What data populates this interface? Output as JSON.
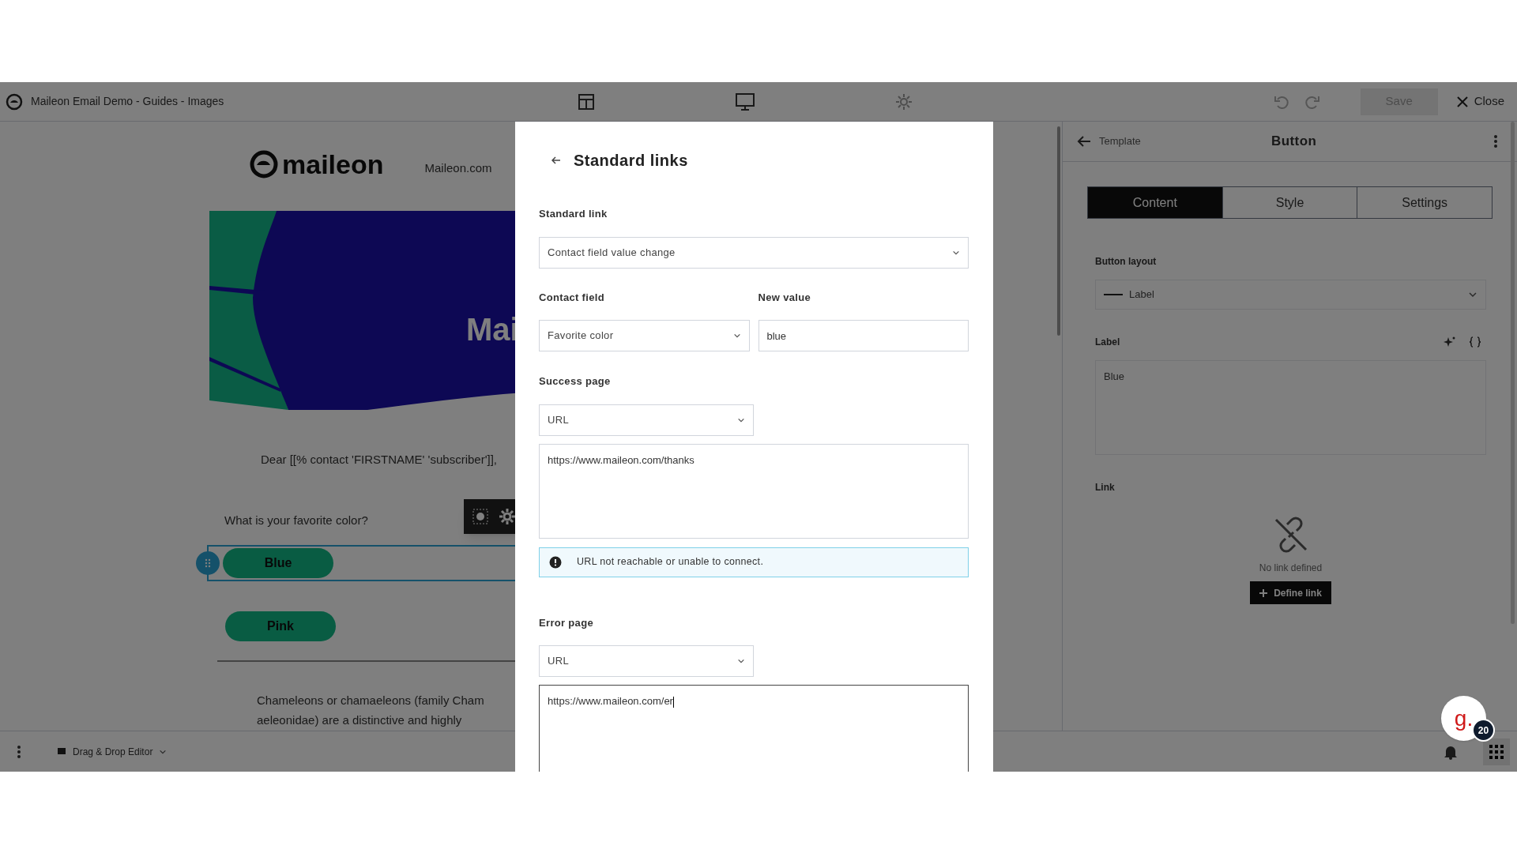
{
  "top_bar": {
    "title": "Maileon Email Demo - Guides - Images",
    "save_label": "Save",
    "close_label": "Close"
  },
  "email": {
    "logo": "maileon",
    "nav_link": "Maileon.com",
    "hero_text": "Mai",
    "greeting": "Dear [[% contact 'FIRSTNAME' 'subscriber']],",
    "question": "What is your favorite color?",
    "buttons": [
      {
        "label": "Blue",
        "selected": true
      },
      {
        "label": "Pink",
        "selected": false
      }
    ],
    "paragraph_lines": [
      "Chameleons or chamaeleons (family Cham",
      "aeleonidae) are a distinctive and highly"
    ]
  },
  "bottom_bar": {
    "editor_label": "Drag & Drop Editor"
  },
  "side_panel": {
    "back_label": "Template",
    "title": "Button",
    "tabs": [
      {
        "label": "Content",
        "selected": true
      },
      {
        "label": "Style",
        "selected": false
      },
      {
        "label": "Settings",
        "selected": false
      }
    ],
    "layout_label": "Button layout",
    "layout_value": "Label",
    "label_label": "Label",
    "label_value": "Blue",
    "link_label": "Link",
    "no_link_text": "No link defined",
    "define_link_label": "Define link"
  },
  "help_badge": {
    "letter": "g.",
    "count": "20"
  },
  "modal": {
    "title": "Standard links",
    "standard_link": {
      "label": "Standard link",
      "value": "Contact field value change"
    },
    "contact_field": {
      "label": "Contact field",
      "value": "Favorite color"
    },
    "new_value": {
      "label": "New value",
      "value": "blue"
    },
    "success_page": {
      "label": "Success page",
      "type": "URL",
      "url": "https://www.maileon.com/thanks",
      "focused": false,
      "alert": "URL not reachable or unable to connect."
    },
    "error_page": {
      "label": "Error page",
      "type": "URL",
      "url": "https://www.maileon.com/er",
      "focused": true
    }
  }
}
